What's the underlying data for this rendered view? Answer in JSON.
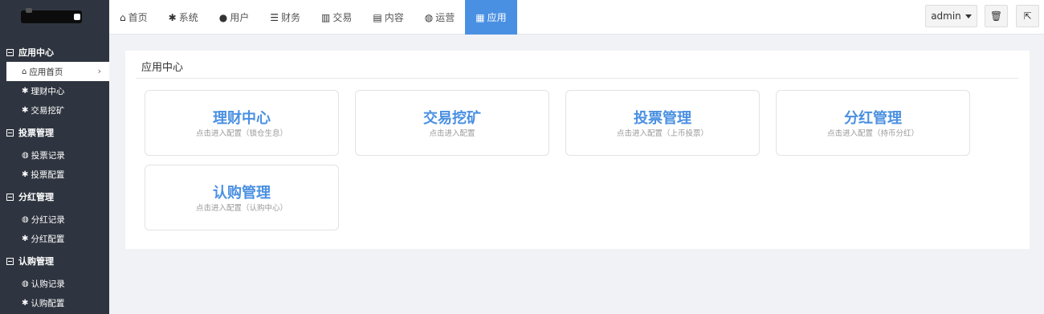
{
  "topnav": {
    "items": [
      {
        "icon": "home-icon",
        "glyph": "⌂",
        "label": "首页"
      },
      {
        "icon": "gear-icon",
        "glyph": "✱",
        "label": "系统"
      },
      {
        "icon": "user-icon",
        "glyph": "●",
        "label": "用户"
      },
      {
        "icon": "list-icon",
        "glyph": "☰",
        "label": "财务"
      },
      {
        "icon": "bar-chart-icon",
        "glyph": "▥",
        "label": "交易"
      },
      {
        "icon": "document-icon",
        "glyph": "▤",
        "label": "内容"
      },
      {
        "icon": "globe-icon",
        "glyph": "◍",
        "label": "运营"
      },
      {
        "icon": "grid-icon",
        "glyph": "▦",
        "label": "应用"
      }
    ],
    "active_label": "应用"
  },
  "toolbar": {
    "user_label": "admin",
    "trash_glyph": "🗑",
    "exit_glyph": "⇱"
  },
  "sidebar": {
    "groups": [
      {
        "label": "应用中心",
        "items": [
          {
            "icon": "home-icon",
            "glyph": "⌂",
            "label": "应用首页",
            "active": true
          },
          {
            "icon": "gear-icon",
            "glyph": "✱",
            "label": "理财中心"
          },
          {
            "icon": "gear-icon",
            "glyph": "✱",
            "label": "交易挖矿"
          }
        ]
      },
      {
        "label": "投票管理",
        "items": [
          {
            "icon": "globe-icon",
            "glyph": "◍",
            "label": "投票记录"
          },
          {
            "icon": "gear-icon",
            "glyph": "✱",
            "label": "投票配置"
          }
        ]
      },
      {
        "label": "分红管理",
        "items": [
          {
            "icon": "globe-icon",
            "glyph": "◍",
            "label": "分红记录"
          },
          {
            "icon": "gear-icon",
            "glyph": "✱",
            "label": "分红配置"
          }
        ]
      },
      {
        "label": "认购管理",
        "items": [
          {
            "icon": "globe-icon",
            "glyph": "◍",
            "label": "认购记录"
          },
          {
            "icon": "gear-icon",
            "glyph": "✱",
            "label": "认购配置"
          }
        ]
      }
    ],
    "chevron_glyph": "›"
  },
  "main": {
    "title": "应用中心",
    "cards": [
      {
        "title": "理财中心",
        "subtitle": "点击进入配置（锁仓生息）"
      },
      {
        "title": "交易挖矿",
        "subtitle": "点击进入配置"
      },
      {
        "title": "投票管理",
        "subtitle": "点击进入配置（上币投票）"
      },
      {
        "title": "分红管理",
        "subtitle": "点击进入配置（持币分红）"
      },
      {
        "title": "认购管理",
        "subtitle": "点击进入配置（认购中心）"
      }
    ]
  },
  "colors": {
    "accent": "#4a90e2",
    "sidebar_bg": "#2f3540",
    "page_bg": "#f1f2f6"
  }
}
